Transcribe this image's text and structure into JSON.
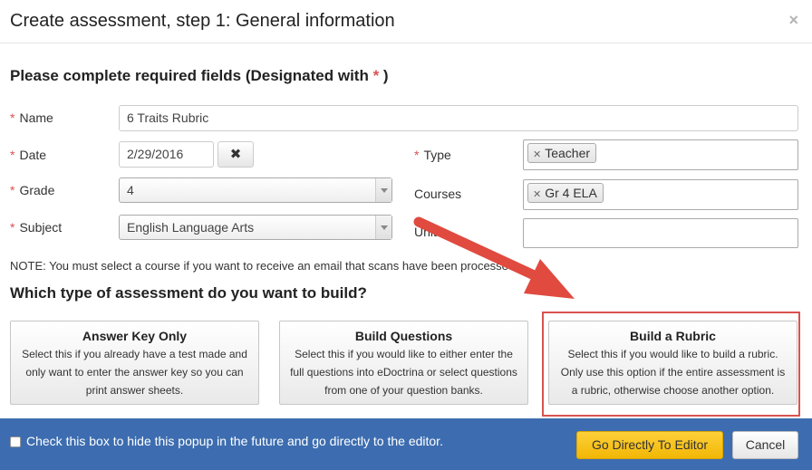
{
  "header": {
    "title": "Create assessment, step 1: General information",
    "close": "×"
  },
  "form": {
    "heading_prefix": "Please complete required fields (Designated with ",
    "required_mark": "*",
    "heading_suffix": " )",
    "name": {
      "label": "Name",
      "value": "6 Traits Rubric"
    },
    "date": {
      "label": "Date",
      "value": "2/29/2016",
      "clear": "✖"
    },
    "grade": {
      "label": "Grade",
      "value": "4"
    },
    "subject": {
      "label": "Subject",
      "value": "English Language Arts"
    },
    "type": {
      "label": "Type",
      "chip": "Teacher"
    },
    "courses": {
      "label": "Courses",
      "chip": "Gr 4 ELA"
    },
    "units": {
      "label": "Units"
    }
  },
  "note": "NOTE: You must select a course if you want to receive an email that scans have been processed.",
  "question": "Which type of assessment do you want to build?",
  "options": [
    {
      "title": "Answer Key Only",
      "desc": "Select this if you already have a test made and only want to enter the answer key so you can print answer sheets."
    },
    {
      "title": "Build Questions",
      "desc": "Select this if you would like to either enter the full questions into eDoctrina or select questions from one of your question banks."
    },
    {
      "title": "Build a Rubric",
      "desc": "Select this if you would like to build a rubric. Only use this option if the entire assessment is a rubric, otherwise choose another option."
    }
  ],
  "footer": {
    "checkbox_label": "Check this box to hide this popup in the future and go directly to the editor.",
    "go_button": "Go Directly To Editor",
    "cancel_button": "Cancel"
  },
  "colors": {
    "required": "#d9534f",
    "footer": "#3d6db0",
    "primary": "#f2b705",
    "annotation": "#e04a3f"
  }
}
